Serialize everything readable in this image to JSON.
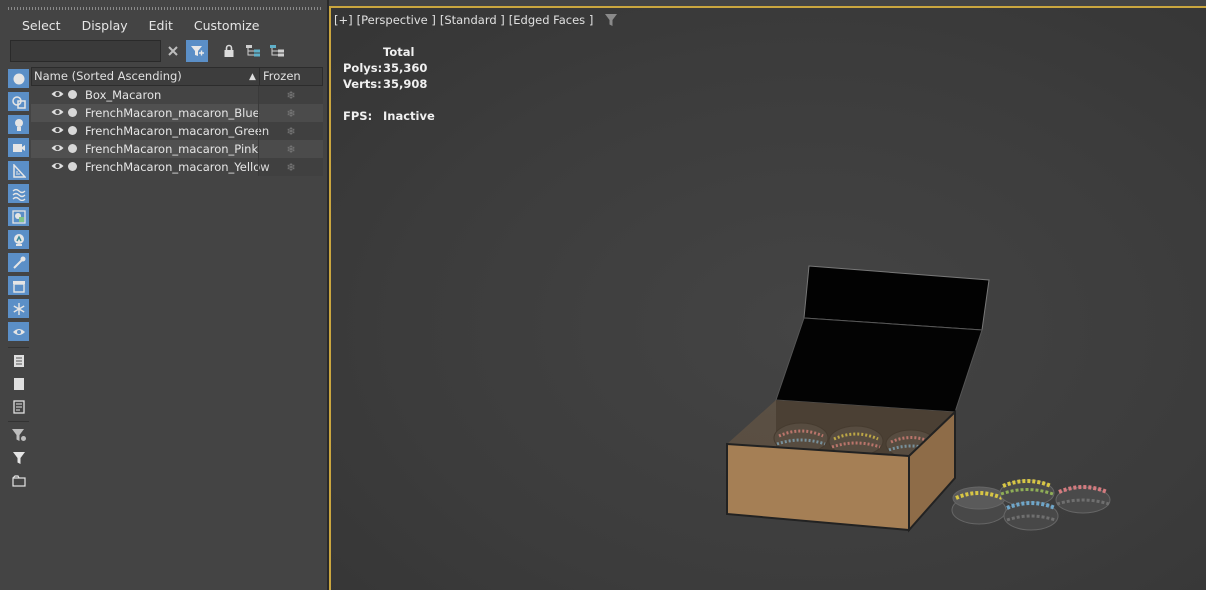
{
  "menu": [
    "Select",
    "Display",
    "Edit",
    "Customize"
  ],
  "search": {
    "value": "",
    "placeholder": ""
  },
  "table": {
    "col_name": "Name (Sorted Ascending)",
    "col_frozen": "Frozen",
    "rows": [
      {
        "name": "Box_Macaron"
      },
      {
        "name": "FrenchMacaron_macaron_Blue"
      },
      {
        "name": "FrenchMacaron_macaron_Green"
      },
      {
        "name": "FrenchMacaron_macaron_Pink"
      },
      {
        "name": "FrenchMacaron_macaron_Yellow"
      }
    ]
  },
  "viewport": {
    "labels": [
      "[+]",
      "[Perspective ]",
      "[Standard ]",
      "[Edged Faces ]"
    ],
    "stats": {
      "total_label": "Total",
      "polys_label": "Polys:",
      "polys_value": "35,360",
      "verts_label": "Verts:",
      "verts_value": "35,908",
      "fps_label": "FPS:",
      "fps_value": "Inactive"
    }
  },
  "filter_strip_icons": [
    "geometry-icon",
    "shapes-icon",
    "lights-icon",
    "cameras-icon",
    "helpers-icon",
    "space-warps-icon",
    "groups-icon",
    "xrefs-icon",
    "bones-icon",
    "containers-icon",
    "frozen-icon",
    "hidden-icon",
    "all-icon",
    "none-icon",
    "invert-icon",
    "filter-options-icon",
    "filter-icon",
    "layer-icon"
  ],
  "colors": {
    "accent": "#5b8fc7",
    "viewport_border": "#caa63f",
    "box_cardboard": "#a57f55",
    "macaron_yellow": "#d8c645",
    "macaron_green": "#8fae57",
    "macaron_blue": "#6fa6c9",
    "macaron_pink": "#d47b7f"
  }
}
